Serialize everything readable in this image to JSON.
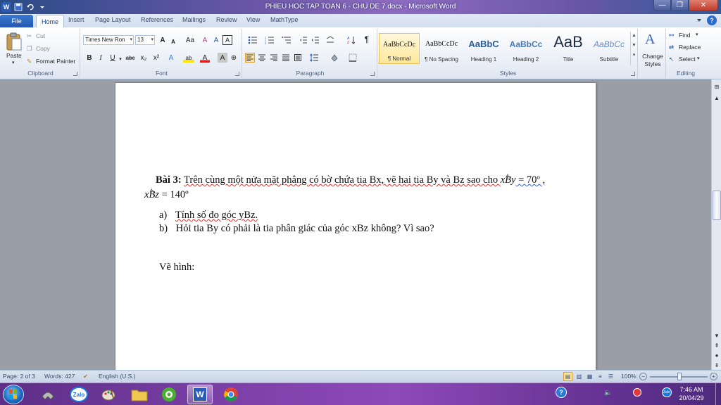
{
  "window": {
    "title": "PHIEU HOC TAP TOAN 6 - CHU DE 7.docx - Microsoft Word",
    "qat_word_icon": "W",
    "min_glyph": "—",
    "max_glyph": "❐",
    "close_glyph": "✕"
  },
  "tabs": {
    "file": "File",
    "home": "Home",
    "insert": "Insert",
    "page_layout": "Page Layout",
    "references": "References",
    "mailings": "Mailings",
    "review": "Review",
    "view": "View",
    "mathtype": "MathType"
  },
  "clipboard": {
    "paste": "Paste",
    "cut": "Cut",
    "copy": "Copy",
    "format_painter": "Format Painter",
    "label": "Clipboard"
  },
  "font": {
    "family": "Times New Ron",
    "size": "13",
    "label": "Font",
    "bold": "B",
    "italic": "I",
    "underline": "U",
    "strike": "abc",
    "subscript": "x₂",
    "superscript": "x²",
    "grow": "A",
    "shrink": "A",
    "change_case": "Aa",
    "clear": "A",
    "phonetic": "A",
    "border_char": "A",
    "effects": "A",
    "highlight": "ab",
    "color": "A"
  },
  "paragraph": {
    "label": "Paragraph",
    "pilcrow": "¶"
  },
  "styles": {
    "label": "Styles",
    "items": [
      {
        "sample": "AaBbCcDc",
        "name": "¶ Normal"
      },
      {
        "sample": "AaBbCcDc",
        "name": "¶ No Spacing"
      },
      {
        "sample": "AaBbC",
        "name": "Heading 1"
      },
      {
        "sample": "AaBbCc",
        "name": "Heading 2"
      },
      {
        "sample": "AaB",
        "name": "Title"
      },
      {
        "sample": "AaBbCc",
        "name": "Subtitle"
      }
    ],
    "change_styles": "Change Styles"
  },
  "editing": {
    "find": "Find",
    "replace": "Replace",
    "select": "Select",
    "label": "Editing"
  },
  "document": {
    "exercise_label": "Bài 3:",
    "intro_a": "Trên cùng một nửa mặt phẳng có bờ chứa tia Bx, vẽ hai tia By và Bz sao cho ",
    "angle1_pre": "x",
    "angle1_vertex": "B",
    "angle1_post": "y",
    "angle1_value": " = 70º ,",
    "angle2_pre": "x",
    "angle2_vertex": "B",
    "angle2_post": "z",
    "angle2_value": " = 140º",
    "hat": "^",
    "item_a_marker": "a)",
    "item_a": "Tính số đo góc yBz.",
    "item_b_marker": "b)",
    "item_b": "Hỏi tia By có phải là tia phân giác của góc xBz không? Vì sao?",
    "draw_label": "Vẽ hình:"
  },
  "statusbar": {
    "page": "Page: 2 of 3",
    "words": "Words: 427",
    "language": "English (U.S.)",
    "zoom": "100%"
  },
  "taskbar": {
    "zalo_label": "Zalo",
    "word_label": "W",
    "time": "7:46 AM",
    "date": "20/04/29"
  },
  "colors": {
    "title_bar": "#6a56a6",
    "file_tab": "#2358b0",
    "taskbar": "#7a3fa6",
    "spell_error": "#d33333",
    "grammar_error": "#3a5fcd"
  }
}
